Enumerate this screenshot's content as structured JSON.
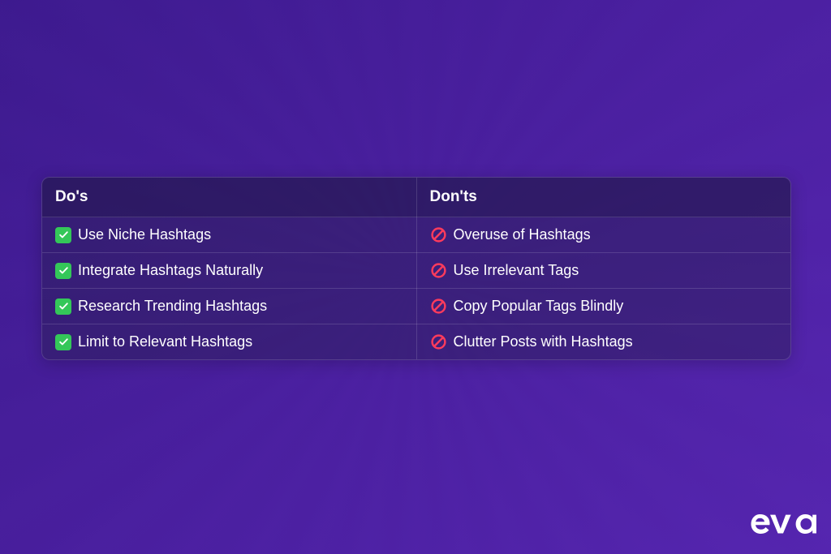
{
  "table": {
    "headers": {
      "dos": "Do's",
      "donts": "Don'ts"
    },
    "rows": [
      {
        "do": "Use Niche Hashtags",
        "dont": "Overuse of Hashtags"
      },
      {
        "do": "Integrate Hashtags Naturally",
        "dont": "Use Irrelevant Tags"
      },
      {
        "do": "Research Trending Hashtags",
        "dont": "Copy Popular Tags Blindly"
      },
      {
        "do": "Limit to Relevant Hashtags",
        "dont": "Clutter Posts with Hashtags"
      }
    ]
  },
  "logo": {
    "text": "eva"
  }
}
